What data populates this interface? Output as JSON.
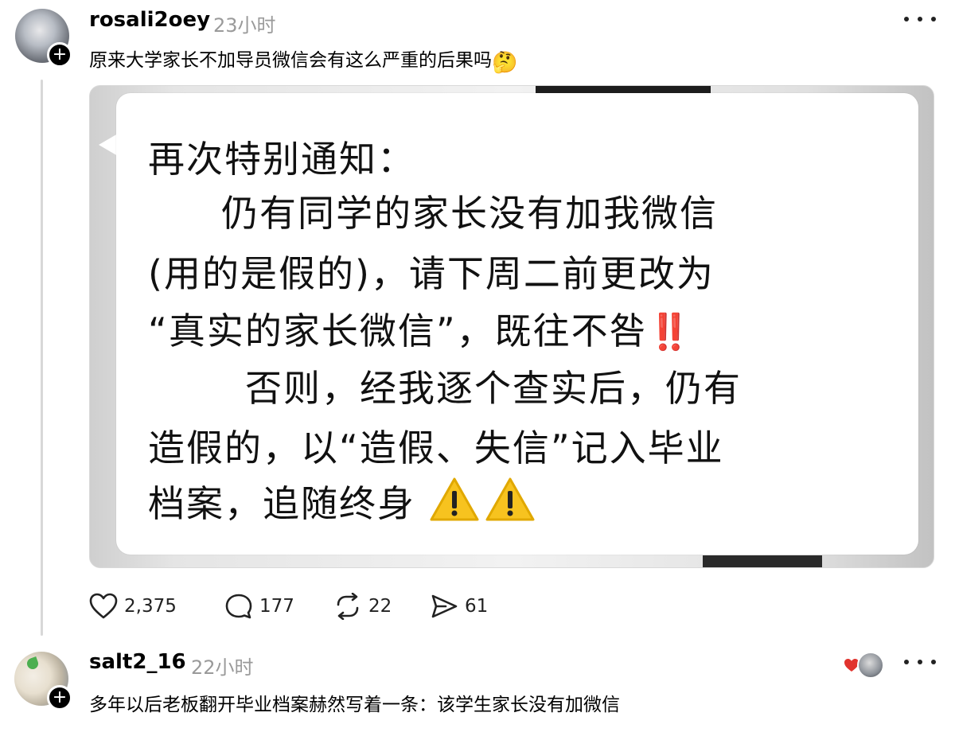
{
  "post": {
    "username": "rosali2oey",
    "time": "23小时",
    "text": "原来大学家长不加导员微信会有这么严重的后果吗",
    "text_emoji": "🤔",
    "image_text": {
      "line1": "再次特别通知：",
      "line2": "仍有同学的家长没有加我微信",
      "line3": "(用的是假的)，请下周二前更改为",
      "line4": "“真实的家长微信”，既往不咎",
      "line4_emoji": "‼️",
      "line5": "否则，经我逐个查实后，仍有",
      "line6": "造假的，以“造假、失信”记入毕业",
      "line7": "档案，追随终身"
    },
    "actions": {
      "likes": "2,375",
      "comments": "177",
      "reposts": "22",
      "shares": "61"
    }
  },
  "reply": {
    "username": "salt2_16",
    "time": "22小时",
    "text": "多年以后老板翻开毕业档案赫然写着一条：该学生家长没有加微信"
  },
  "icons": {
    "follow": "plus-icon",
    "more": "more-horizontal-icon",
    "like": "heart-icon",
    "comment": "comment-bubble-icon",
    "repost": "repost-icon",
    "share": "send-icon",
    "warning": "warning-icon"
  },
  "colors": {
    "accent_red": "#e1332d",
    "warning_yellow": "#f7c31f",
    "muted_text": "#9a9a9a"
  }
}
